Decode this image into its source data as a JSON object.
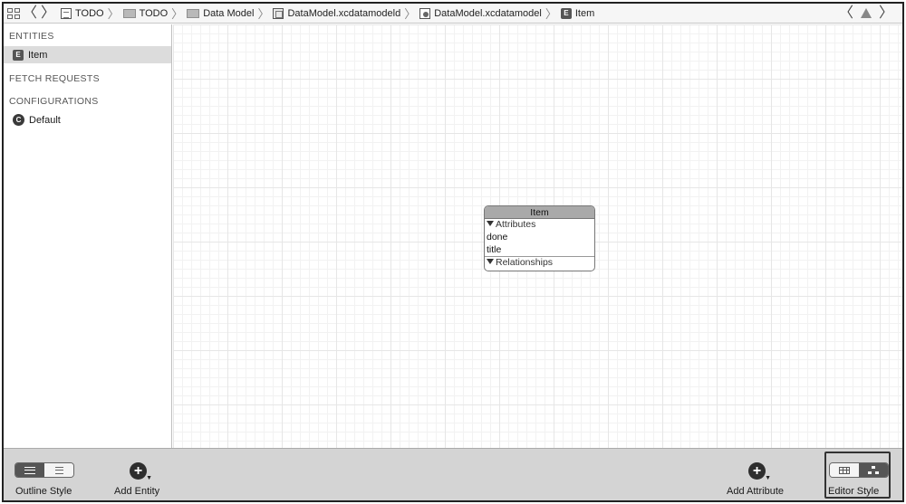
{
  "jumpbar": {
    "crumbs": [
      {
        "label": "TODO",
        "icon": "file-icon"
      },
      {
        "label": "TODO",
        "icon": "folder-icon"
      },
      {
        "label": "Data Model",
        "icon": "folder-icon"
      },
      {
        "label": "DataModel.xcdatamodeld",
        "icon": "data-model-bundle-icon"
      },
      {
        "label": "DataModel.xcdatamodel",
        "icon": "data-model-file-icon"
      },
      {
        "label": "Item",
        "icon": "entity-icon"
      }
    ],
    "separator": "〉",
    "back_glyph": "〈",
    "forward_glyph": "〉",
    "entity_badge": "E"
  },
  "sidebar": {
    "entities_title": "ENTITIES",
    "entities": [
      {
        "label": "Item",
        "badge": "E"
      }
    ],
    "fetch_requests_title": "FETCH REQUESTS",
    "configurations_title": "CONFIGURATIONS",
    "configurations": [
      {
        "label": "Default",
        "badge": "C"
      }
    ]
  },
  "canvas": {
    "entity": {
      "name": "Item",
      "attributes_label": "Attributes",
      "attributes": [
        "done",
        "title"
      ],
      "relationships_label": "Relationships"
    }
  },
  "bottombar": {
    "outline_style_label": "Outline Style",
    "add_entity_label": "Add Entity",
    "add_attribute_label": "Add Attribute",
    "editor_style_label": "Editor Style",
    "plus_glyph": "+"
  }
}
